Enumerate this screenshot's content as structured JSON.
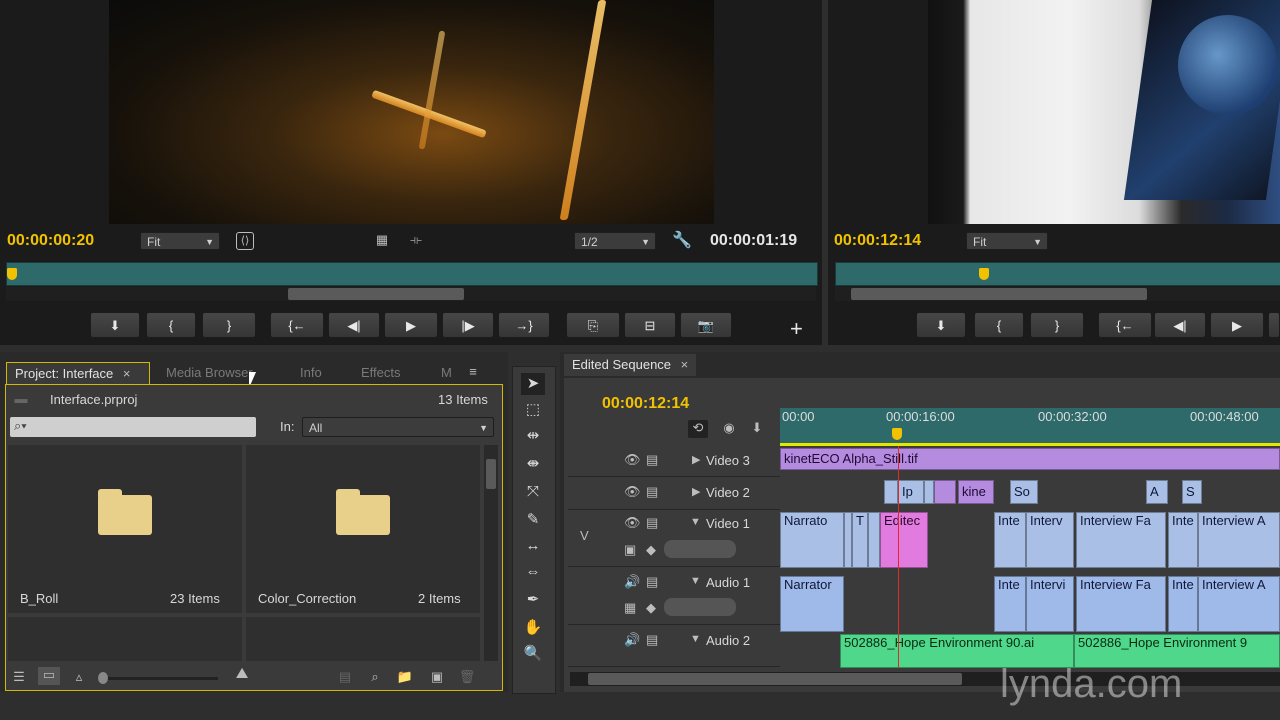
{
  "source_monitor": {
    "timecode_left": "00:00:00:20",
    "zoom": "Fit",
    "resolution": "1/2",
    "timecode_right": "00:00:01:19"
  },
  "program_monitor": {
    "timecode_left": "00:00:12:14",
    "zoom": "Fit"
  },
  "transport": {
    "add_label": "+"
  },
  "project_panel": {
    "tabs": [
      {
        "label": "Project: Interface",
        "close": "×"
      },
      {
        "label": "Media Browser"
      },
      {
        "label": "Info"
      },
      {
        "label": "Effects"
      },
      {
        "label": "M"
      }
    ],
    "project_name": "Interface.prproj",
    "item_count": "13 Items",
    "search_placeholder": "",
    "in_label": "In:",
    "in_value": "All",
    "bins": [
      {
        "name": "B_Roll",
        "count": "23 Items"
      },
      {
        "name": "Color_Correction",
        "count": "2 Items"
      }
    ]
  },
  "sequence": {
    "tab_label": "Edited Sequence",
    "tab_close": "×",
    "timecode": "00:00:12:14",
    "ruler": [
      "00:00",
      "00:00:16:00",
      "00:00:32:00",
      "00:00:48:00"
    ],
    "tracks": {
      "video3": "Video 3",
      "video2": "Video 2",
      "video1": "Video 1",
      "audio1": "Audio 1",
      "audio2": "Audio 2",
      "target_v": "V"
    },
    "clips": {
      "v3": "kinetECO Alpha_Still.tif",
      "v2a": "Ip",
      "v2b": "kine",
      "v2c": "So",
      "v2d": "A",
      "v2e": "S",
      "v1a": "Narrato",
      "v1b": "T",
      "v1c": "Editec",
      "v1d": "Inte",
      "v1e": "Interv",
      "v1f": "Interview Fa",
      "v1g": "Inte",
      "v1h": "Interview A",
      "a1a": "Narrator",
      "a1b": "Inte",
      "a1c": "Intervi",
      "a1d": "Interview Fa",
      "a1e": "Inte",
      "a1f": "Interview A",
      "a2a": "502886_Hope Environment 90.ai",
      "a2b": "502886_Hope Environment 9"
    }
  },
  "watermark": "lynda.com",
  "colors": {
    "timecode_yellow": "#f2c200",
    "scrub_teal": "#2f6a6a",
    "video_clip": "#a9bfe6",
    "title_clip": "#e27be0",
    "audio2_clip": "#4fd88b"
  }
}
